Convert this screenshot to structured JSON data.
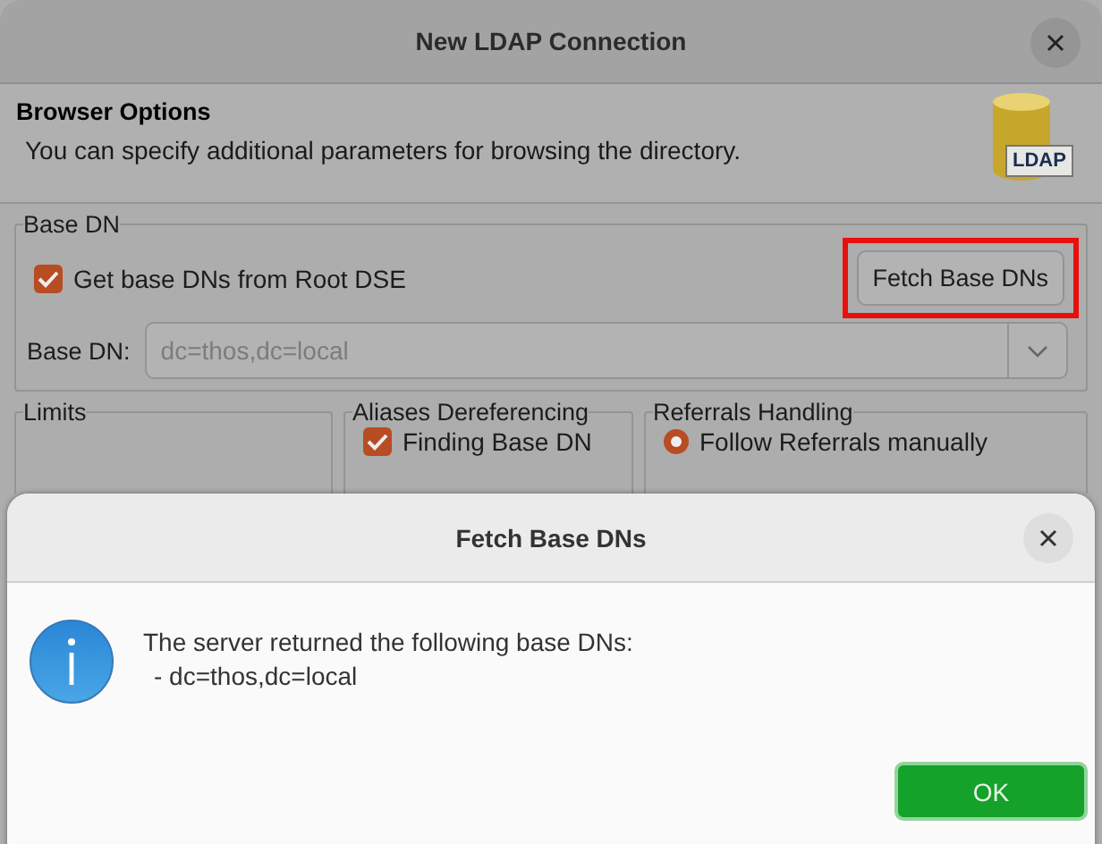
{
  "window": {
    "title": "New LDAP Connection"
  },
  "header": {
    "title": "Browser Options",
    "description": "You can specify additional parameters for browsing the directory.",
    "logo_text": "LDAP"
  },
  "base_dn_group": {
    "title": "Base DN",
    "get_from_root_dse": {
      "label": "Get base DNs from Root DSE",
      "checked": true
    },
    "fetch_button": {
      "label": "Fetch Base DNs",
      "highlighted": true
    },
    "base_dn_field": {
      "label": "Base DN:",
      "value": "dc=thos,dc=local",
      "disabled": true
    }
  },
  "groups": [
    {
      "title": "Limits"
    },
    {
      "title": "Aliases Dereferencing",
      "items": [
        {
          "kind": "checkbox",
          "label": "Finding Base DN",
          "checked": true
        }
      ]
    },
    {
      "title": "Referrals Handling",
      "items": [
        {
          "kind": "radio",
          "label": "Follow Referrals manually",
          "selected": true
        }
      ]
    }
  ],
  "dialog": {
    "title": "Fetch Base DNs",
    "message": "The server returned the following base DNs:",
    "entries": [
      "- dc=thos,dc=local"
    ],
    "buttons": [
      "OK"
    ]
  }
}
